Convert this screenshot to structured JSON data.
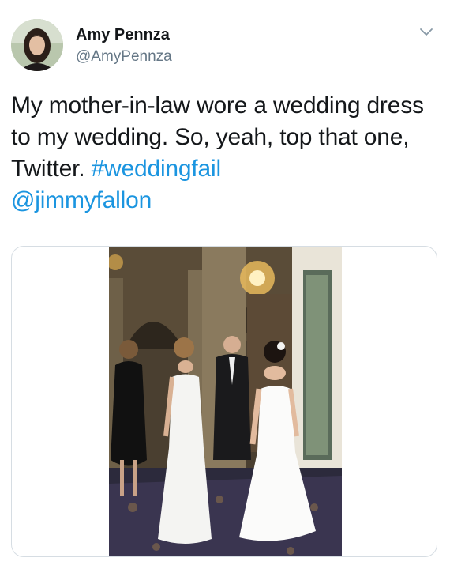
{
  "author": {
    "display_name": "Amy Pennza",
    "handle": "@AmyPennza",
    "avatar_icon": "profile-avatar"
  },
  "menu": {
    "icon": "chevron-down-icon"
  },
  "tweet": {
    "text_plain": "My mother-in-law wore a wedding dress to my wedding. So, yeah, top that one, Twitter. ",
    "hashtag": "#weddingfail",
    "mention": "@jimmyfallon"
  },
  "media": {
    "type": "photo",
    "subject": "wedding-photo"
  },
  "colors": {
    "text": "#14171a",
    "secondary": "#657786",
    "link": "#1b95e0",
    "border": "#d6dde3"
  }
}
